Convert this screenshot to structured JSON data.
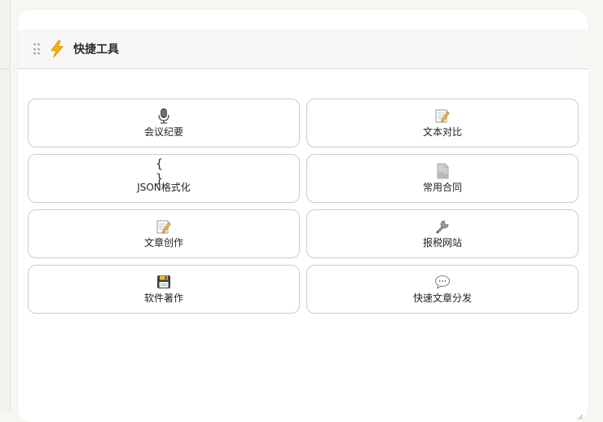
{
  "widget": {
    "title": "快捷工具",
    "title_icon": "lightning-icon",
    "accent_color": "#f5a623"
  },
  "tools": [
    {
      "label": "会议纪要",
      "icon": "microphone-icon"
    },
    {
      "label": "文本对比",
      "icon": "memo-icon"
    },
    {
      "label": "JSON格式化",
      "icon": "braces-icon",
      "glyph": "{ }"
    },
    {
      "label": "常用合同",
      "icon": "document-icon"
    },
    {
      "label": "文章创作",
      "icon": "memo-icon"
    },
    {
      "label": "报税网站",
      "icon": "wrench-icon"
    },
    {
      "label": "软件著作",
      "icon": "floppy-disk-icon"
    },
    {
      "label": "快速文章分发",
      "icon": "speech-bubble-icon"
    }
  ]
}
